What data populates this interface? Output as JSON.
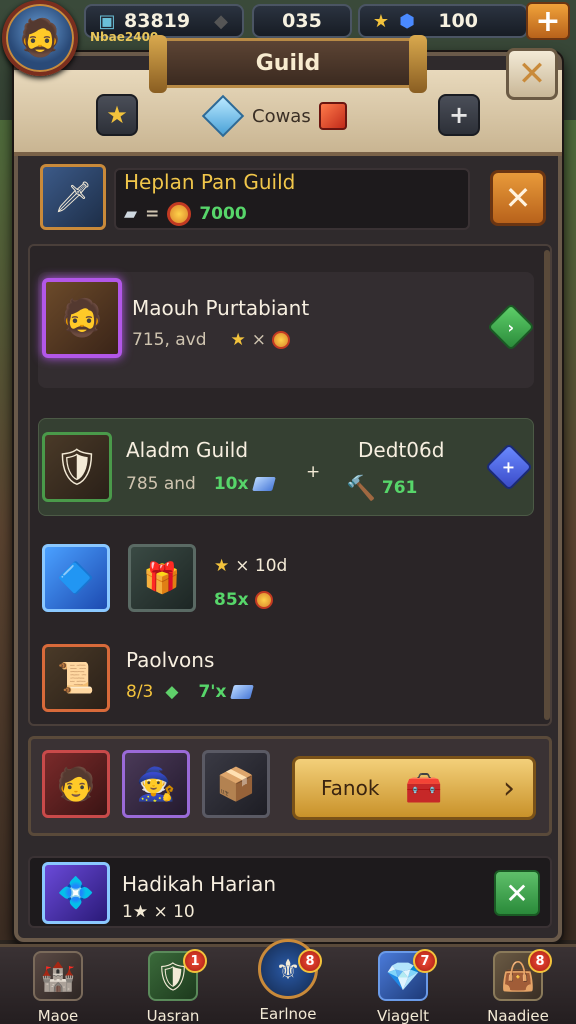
{
  "topbar": {
    "resource1_value": "83819",
    "resource1_sub": "Nbae2400",
    "resource2_value": "035",
    "resource3_value": "100"
  },
  "header": {
    "title": "Guild",
    "currency_label": "Cowas"
  },
  "guild": {
    "name": "Heplan Pan Guild",
    "meta_sep": "=",
    "value": "7000"
  },
  "cards": [
    {
      "title": "Maouh Purtabiant",
      "sub_left": "715, avd",
      "sub_right": "×"
    },
    {
      "title": "Aladm Guild",
      "sub_left": "785 and",
      "count": "10x",
      "plus": "+",
      "right_title": "Dedt06d",
      "right_value": "761"
    }
  ],
  "items": {
    "row1_stat1": "× 10d",
    "row1_stat2": "85x",
    "row2_title": "Paolvons",
    "row2_left": "8/3",
    "row2_right": "7'x"
  },
  "bottom": {
    "button_label": "Fanok",
    "chevron": "›"
  },
  "reward": {
    "title": "Hadikah Harian",
    "value": "1★ × 10"
  },
  "nav": [
    {
      "label": "Maoe",
      "badge": ""
    },
    {
      "label": "Uasran",
      "badge": "1"
    },
    {
      "label": "Earlnoe",
      "badge": "8"
    },
    {
      "label": "Viagelt",
      "badge": "7"
    },
    {
      "label": "Naadiee",
      "badge": "8"
    }
  ]
}
